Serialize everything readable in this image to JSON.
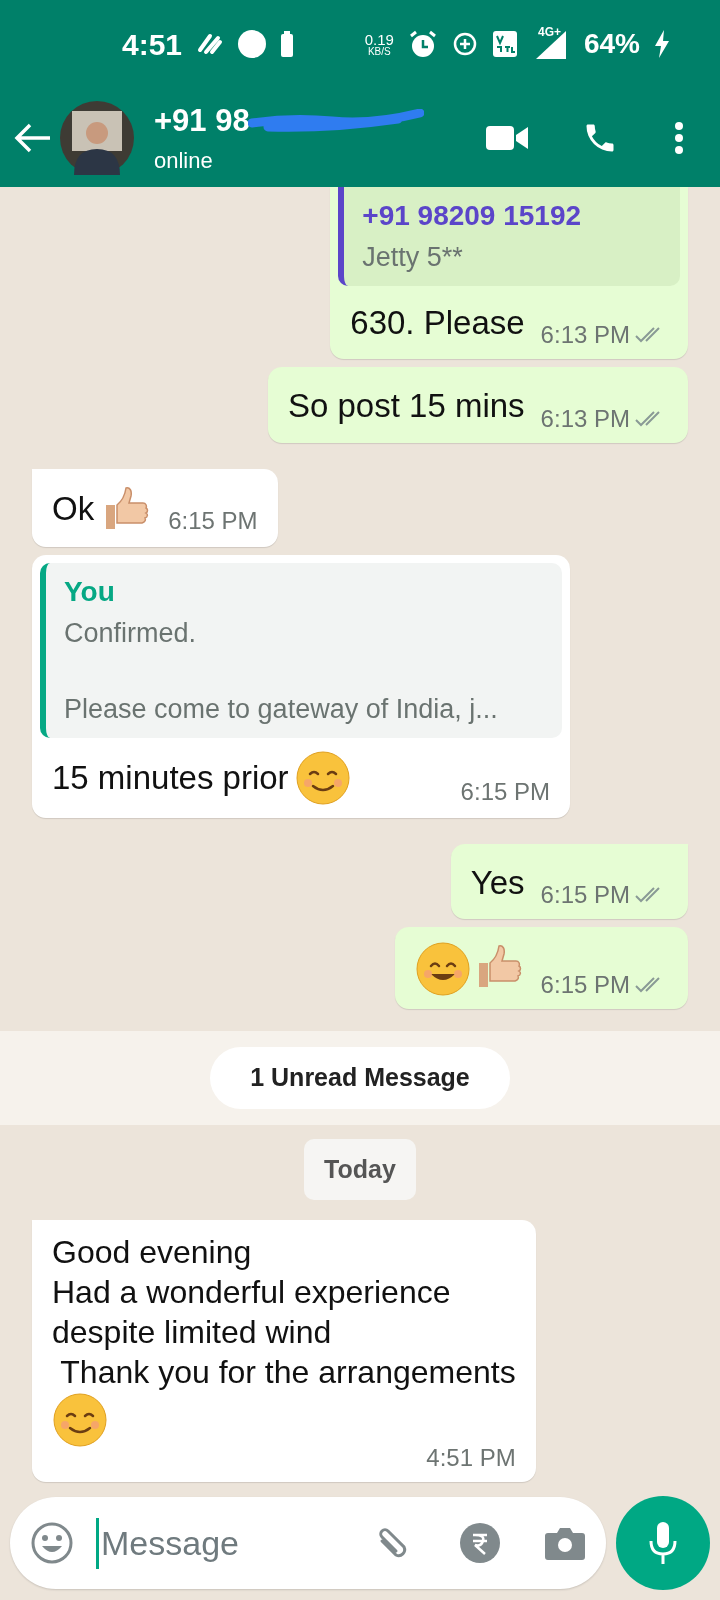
{
  "status_bar": {
    "time": "4:51",
    "speed": "0.19",
    "speed_unit": "KB/S",
    "network": "4G+",
    "battery": "64%"
  },
  "header": {
    "name": "+91 98",
    "presence": "online"
  },
  "messages": [
    {
      "kind": "outgoing",
      "quote": {
        "author": "+91 98209 15192",
        "text": "Jetty 5**",
        "color": "#5b45c9"
      },
      "text": "630. Please",
      "time": "6:13 PM",
      "read": false,
      "cut_top": true
    },
    {
      "kind": "outgoing",
      "text": "So post 15 mins",
      "time": "6:13 PM",
      "read": false
    },
    {
      "kind": "incoming",
      "text": "Ok",
      "emoji": [
        {
          "kind": "thumbs_up"
        }
      ],
      "time": "6:15 PM",
      "tail": true
    },
    {
      "kind": "incoming",
      "quote": {
        "author": "You",
        "text": "Confirmed.",
        "text2": "Please come to gateway of India,  j...",
        "color": "#06a884"
      },
      "text": "15 minutes prior",
      "emoji": [
        {
          "kind": "blush"
        }
      ],
      "time": "6:15 PM"
    },
    {
      "kind": "outgoing",
      "text": "Yes",
      "time": "6:15 PM",
      "read": false,
      "tail": true
    },
    {
      "kind": "outgoing",
      "emoji": [
        {
          "kind": "smile"
        },
        {
          "kind": "thumbs_up"
        }
      ],
      "time": "6:15 PM",
      "read": false
    },
    {
      "kind": "unread",
      "text": "1 Unread Message"
    },
    {
      "kind": "date",
      "text": "Today"
    },
    {
      "kind": "incoming",
      "lines": [
        "Good evening",
        "Had a wonderful experience",
        "despite limited wind",
        " Thank you for the arrangements"
      ],
      "emoji": [
        {
          "kind": "blush"
        }
      ],
      "time": "4:51 PM",
      "tail": true
    }
  ],
  "composer": {
    "placeholder": "Message"
  }
}
